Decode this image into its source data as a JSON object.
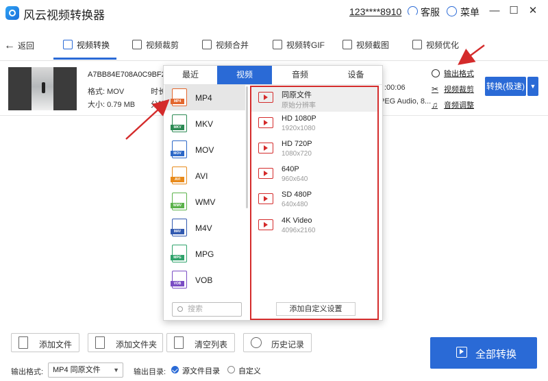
{
  "titlebar": {
    "app_title": "风云视频转换器",
    "phone": "123****8910",
    "service": "客服",
    "menu": "菜单",
    "minimize": "—",
    "maximize": "☐",
    "close": "✕"
  },
  "toolbar": {
    "back": "返回",
    "tabs": [
      {
        "label": "视频转换",
        "icon": "video-convert-icon"
      },
      {
        "label": "视频裁剪",
        "icon": "crop-icon"
      },
      {
        "label": "视频合并",
        "icon": "merge-icon"
      },
      {
        "label": "视频转GIF",
        "icon": "gif-icon"
      },
      {
        "label": "视频截图",
        "icon": "screenshot-icon"
      },
      {
        "label": "视频优化",
        "icon": "optimize-icon"
      }
    ]
  },
  "file": {
    "name": "A7BB84E708A0C9BF2!",
    "format": "格式: MOV",
    "size": "大小: 0.79 MB",
    "duration_label": "时长",
    "resolution_label": "分辨",
    "time": ":00:06",
    "audio": "PEG Audio, 8...",
    "links": [
      "输出格式",
      "视频裁剪",
      "音频调整"
    ],
    "convert_btn": "转换(极速)"
  },
  "popup": {
    "tabs": [
      "最近",
      "视频",
      "音频",
      "设备"
    ],
    "active_tab": 1,
    "formats": [
      {
        "label": "MP4",
        "color": "#e2662d"
      },
      {
        "label": "MKV",
        "color": "#2b8a53"
      },
      {
        "label": "MOV",
        "color": "#2b67c7"
      },
      {
        "label": "AVI",
        "color": "#e88a1a"
      },
      {
        "label": "WMV",
        "color": "#5ab24a"
      },
      {
        "label": "M4V",
        "color": "#3159b0"
      },
      {
        "label": "MPG",
        "color": "#2fa36b"
      },
      {
        "label": "VOB",
        "color": "#7a4cc4"
      }
    ],
    "search_placeholder": "搜索",
    "qualities": [
      {
        "name": "同原文件",
        "res": "原始分辨率"
      },
      {
        "name": "HD 1080P",
        "res": "1920x1080"
      },
      {
        "name": "HD 720P",
        "res": "1080x720"
      },
      {
        "name": "640P",
        "res": "960x640"
      },
      {
        "name": "SD 480P",
        "res": "640x480"
      },
      {
        "name": "4K Video",
        "res": "4096x2160"
      }
    ],
    "custom_btn": "添加自定义设置"
  },
  "bottom": {
    "add_file": "添加文件",
    "add_folder": "添加文件夹",
    "clear_list": "清空列表",
    "history": "历史记录",
    "convert_all": "全部转换",
    "output_format_label": "输出格式:",
    "output_format_value": "MP4 同原文件",
    "output_dir_label": "输出目录:",
    "dir_source": "源文件目录",
    "dir_custom": "自定义"
  },
  "colors": {
    "accent": "#2a6ad6",
    "annotation_red": "#d42b2b"
  }
}
